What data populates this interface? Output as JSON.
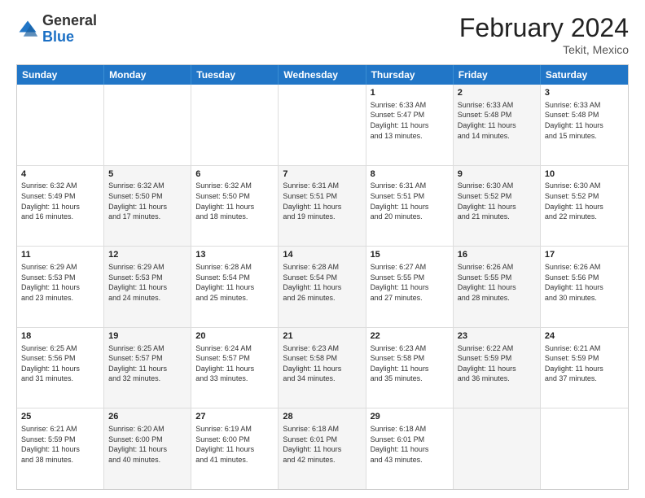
{
  "header": {
    "logo_general": "General",
    "logo_blue": "Blue",
    "month_title": "February 2024",
    "location": "Tekit, Mexico"
  },
  "weekdays": [
    "Sunday",
    "Monday",
    "Tuesday",
    "Wednesday",
    "Thursday",
    "Friday",
    "Saturday"
  ],
  "rows": [
    [
      {
        "day": "",
        "lines": [],
        "shaded": false
      },
      {
        "day": "",
        "lines": [],
        "shaded": false
      },
      {
        "day": "",
        "lines": [],
        "shaded": false
      },
      {
        "day": "",
        "lines": [],
        "shaded": false
      },
      {
        "day": "1",
        "lines": [
          "Sunrise: 6:33 AM",
          "Sunset: 5:47 PM",
          "Daylight: 11 hours",
          "and 13 minutes."
        ],
        "shaded": false
      },
      {
        "day": "2",
        "lines": [
          "Sunrise: 6:33 AM",
          "Sunset: 5:48 PM",
          "Daylight: 11 hours",
          "and 14 minutes."
        ],
        "shaded": true
      },
      {
        "day": "3",
        "lines": [
          "Sunrise: 6:33 AM",
          "Sunset: 5:48 PM",
          "Daylight: 11 hours",
          "and 15 minutes."
        ],
        "shaded": false
      }
    ],
    [
      {
        "day": "4",
        "lines": [
          "Sunrise: 6:32 AM",
          "Sunset: 5:49 PM",
          "Daylight: 11 hours",
          "and 16 minutes."
        ],
        "shaded": false
      },
      {
        "day": "5",
        "lines": [
          "Sunrise: 6:32 AM",
          "Sunset: 5:50 PM",
          "Daylight: 11 hours",
          "and 17 minutes."
        ],
        "shaded": true
      },
      {
        "day": "6",
        "lines": [
          "Sunrise: 6:32 AM",
          "Sunset: 5:50 PM",
          "Daylight: 11 hours",
          "and 18 minutes."
        ],
        "shaded": false
      },
      {
        "day": "7",
        "lines": [
          "Sunrise: 6:31 AM",
          "Sunset: 5:51 PM",
          "Daylight: 11 hours",
          "and 19 minutes."
        ],
        "shaded": true
      },
      {
        "day": "8",
        "lines": [
          "Sunrise: 6:31 AM",
          "Sunset: 5:51 PM",
          "Daylight: 11 hours",
          "and 20 minutes."
        ],
        "shaded": false
      },
      {
        "day": "9",
        "lines": [
          "Sunrise: 6:30 AM",
          "Sunset: 5:52 PM",
          "Daylight: 11 hours",
          "and 21 minutes."
        ],
        "shaded": true
      },
      {
        "day": "10",
        "lines": [
          "Sunrise: 6:30 AM",
          "Sunset: 5:52 PM",
          "Daylight: 11 hours",
          "and 22 minutes."
        ],
        "shaded": false
      }
    ],
    [
      {
        "day": "11",
        "lines": [
          "Sunrise: 6:29 AM",
          "Sunset: 5:53 PM",
          "Daylight: 11 hours",
          "and 23 minutes."
        ],
        "shaded": false
      },
      {
        "day": "12",
        "lines": [
          "Sunrise: 6:29 AM",
          "Sunset: 5:53 PM",
          "Daylight: 11 hours",
          "and 24 minutes."
        ],
        "shaded": true
      },
      {
        "day": "13",
        "lines": [
          "Sunrise: 6:28 AM",
          "Sunset: 5:54 PM",
          "Daylight: 11 hours",
          "and 25 minutes."
        ],
        "shaded": false
      },
      {
        "day": "14",
        "lines": [
          "Sunrise: 6:28 AM",
          "Sunset: 5:54 PM",
          "Daylight: 11 hours",
          "and 26 minutes."
        ],
        "shaded": true
      },
      {
        "day": "15",
        "lines": [
          "Sunrise: 6:27 AM",
          "Sunset: 5:55 PM",
          "Daylight: 11 hours",
          "and 27 minutes."
        ],
        "shaded": false
      },
      {
        "day": "16",
        "lines": [
          "Sunrise: 6:26 AM",
          "Sunset: 5:55 PM",
          "Daylight: 11 hours",
          "and 28 minutes."
        ],
        "shaded": true
      },
      {
        "day": "17",
        "lines": [
          "Sunrise: 6:26 AM",
          "Sunset: 5:56 PM",
          "Daylight: 11 hours",
          "and 30 minutes."
        ],
        "shaded": false
      }
    ],
    [
      {
        "day": "18",
        "lines": [
          "Sunrise: 6:25 AM",
          "Sunset: 5:56 PM",
          "Daylight: 11 hours",
          "and 31 minutes."
        ],
        "shaded": false
      },
      {
        "day": "19",
        "lines": [
          "Sunrise: 6:25 AM",
          "Sunset: 5:57 PM",
          "Daylight: 11 hours",
          "and 32 minutes."
        ],
        "shaded": true
      },
      {
        "day": "20",
        "lines": [
          "Sunrise: 6:24 AM",
          "Sunset: 5:57 PM",
          "Daylight: 11 hours",
          "and 33 minutes."
        ],
        "shaded": false
      },
      {
        "day": "21",
        "lines": [
          "Sunrise: 6:23 AM",
          "Sunset: 5:58 PM",
          "Daylight: 11 hours",
          "and 34 minutes."
        ],
        "shaded": true
      },
      {
        "day": "22",
        "lines": [
          "Sunrise: 6:23 AM",
          "Sunset: 5:58 PM",
          "Daylight: 11 hours",
          "and 35 minutes."
        ],
        "shaded": false
      },
      {
        "day": "23",
        "lines": [
          "Sunrise: 6:22 AM",
          "Sunset: 5:59 PM",
          "Daylight: 11 hours",
          "and 36 minutes."
        ],
        "shaded": true
      },
      {
        "day": "24",
        "lines": [
          "Sunrise: 6:21 AM",
          "Sunset: 5:59 PM",
          "Daylight: 11 hours",
          "and 37 minutes."
        ],
        "shaded": false
      }
    ],
    [
      {
        "day": "25",
        "lines": [
          "Sunrise: 6:21 AM",
          "Sunset: 5:59 PM",
          "Daylight: 11 hours",
          "and 38 minutes."
        ],
        "shaded": false
      },
      {
        "day": "26",
        "lines": [
          "Sunrise: 6:20 AM",
          "Sunset: 6:00 PM",
          "Daylight: 11 hours",
          "and 40 minutes."
        ],
        "shaded": true
      },
      {
        "day": "27",
        "lines": [
          "Sunrise: 6:19 AM",
          "Sunset: 6:00 PM",
          "Daylight: 11 hours",
          "and 41 minutes."
        ],
        "shaded": false
      },
      {
        "day": "28",
        "lines": [
          "Sunrise: 6:18 AM",
          "Sunset: 6:01 PM",
          "Daylight: 11 hours",
          "and 42 minutes."
        ],
        "shaded": true
      },
      {
        "day": "29",
        "lines": [
          "Sunrise: 6:18 AM",
          "Sunset: 6:01 PM",
          "Daylight: 11 hours",
          "and 43 minutes."
        ],
        "shaded": false
      },
      {
        "day": "",
        "lines": [],
        "shaded": true
      },
      {
        "day": "",
        "lines": [],
        "shaded": false
      }
    ]
  ]
}
